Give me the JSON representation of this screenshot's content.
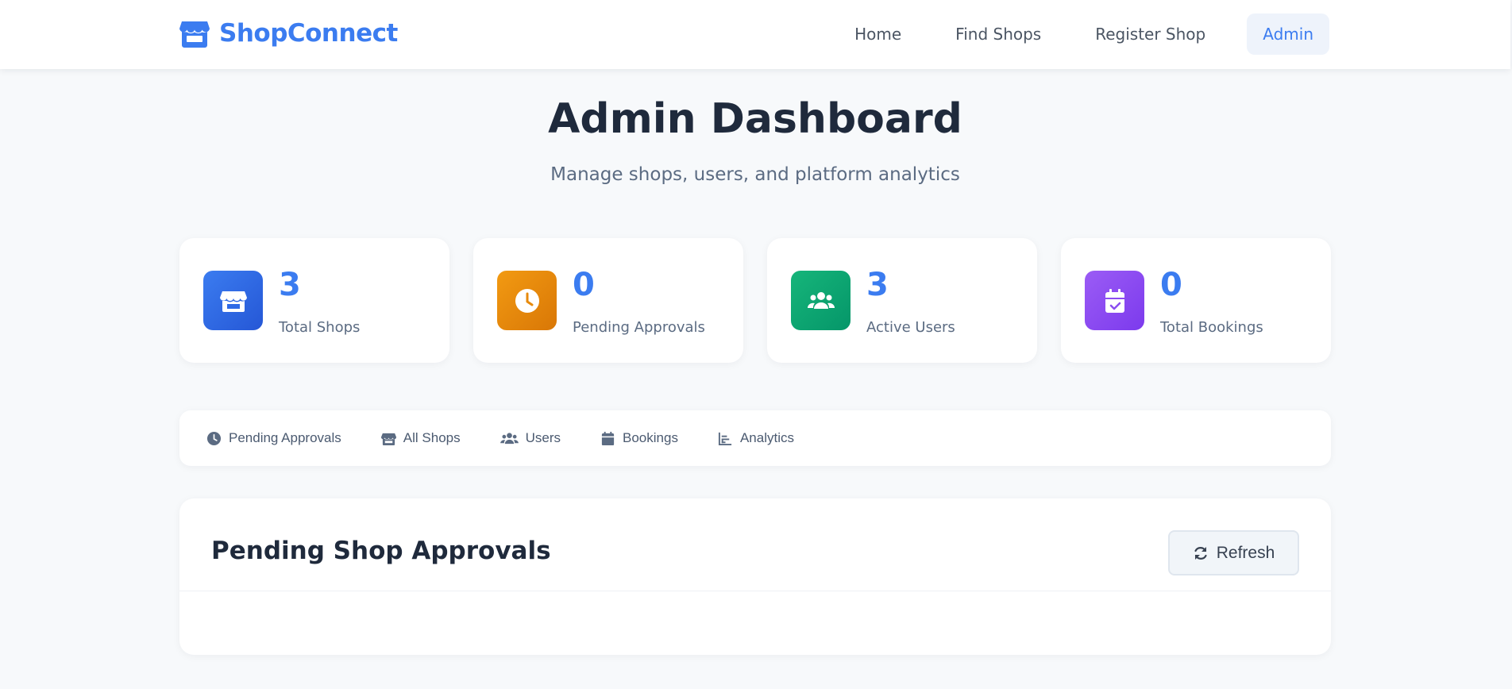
{
  "nav": {
    "brand": "ShopConnect",
    "links": [
      {
        "label": "Home"
      },
      {
        "label": "Find Shops"
      },
      {
        "label": "Register Shop"
      },
      {
        "label": "Admin"
      }
    ]
  },
  "header": {
    "title": "Admin Dashboard",
    "subtitle": "Manage shops, users, and platform analytics"
  },
  "stats": [
    {
      "value": "3",
      "label": "Total Shops",
      "icon": "store-icon",
      "color": "#2f6ae6"
    },
    {
      "value": "0",
      "label": "Pending Approvals",
      "icon": "clock-icon",
      "color": "#e78a0c"
    },
    {
      "value": "3",
      "label": "Active Users",
      "icon": "users-icon",
      "color": "#12a86f"
    },
    {
      "value": "0",
      "label": "Total Bookings",
      "icon": "calendar-check-icon",
      "color": "#8b4ff0"
    }
  ],
  "tabs": [
    {
      "label": "Pending Approvals",
      "icon": "clock-icon"
    },
    {
      "label": "All Shops",
      "icon": "store-icon"
    },
    {
      "label": "Users",
      "icon": "users-icon"
    },
    {
      "label": "Bookings",
      "icon": "calendar-icon"
    },
    {
      "label": "Analytics",
      "icon": "chart-icon"
    }
  ],
  "panel": {
    "title": "Pending Shop Approvals",
    "refresh_label": "Refresh"
  },
  "colors": {
    "accent": "#3b7cf0",
    "background": "#f7f9fb"
  }
}
